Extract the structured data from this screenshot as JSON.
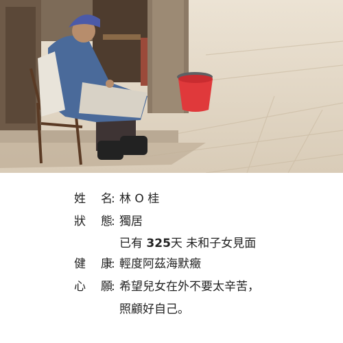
{
  "photo": {
    "subject": "elderly woman seated on a chair beside a doorway with a red bucket on a stone street"
  },
  "profile": {
    "name_label_1": "姓",
    "name_label_2": "名",
    "name_value": "林 O 桂",
    "status_label_1": "狀",
    "status_label_2": "態",
    "status_value": "獨居",
    "status_detail_prefix": "已有 ",
    "status_detail_days": "325",
    "status_detail_suffix": "天 未和子女見面",
    "health_label_1": "健",
    "health_label_2": "康",
    "health_value": "輕度阿茲海默癥",
    "wish_label_1": "心",
    "wish_label_2": "願",
    "wish_value_line1": "希望兒女在外不要太辛苦，",
    "wish_value_line2": "照顧好自己。",
    "colon": ":"
  },
  "colors": {
    "text": "#222222",
    "bucket": "#e0393b",
    "street": "#e7dccb"
  }
}
